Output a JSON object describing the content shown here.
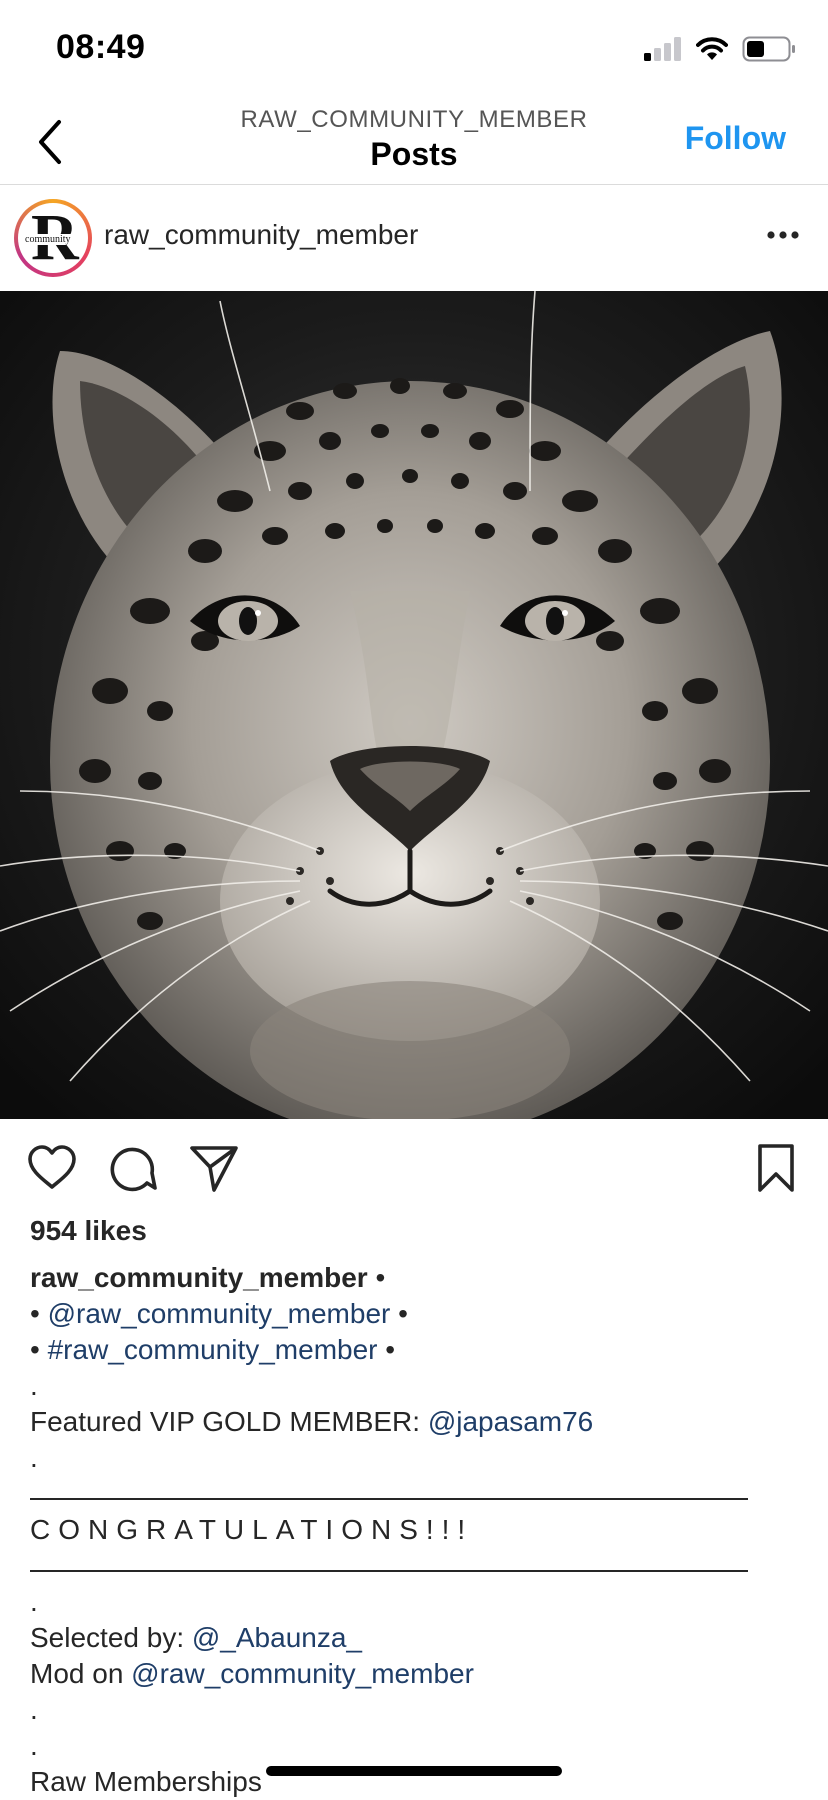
{
  "status_bar": {
    "time": "08:49"
  },
  "nav": {
    "subtitle": "RAW_COMMUNITY_MEMBER",
    "title": "Posts",
    "follow_label": "Follow"
  },
  "post": {
    "username": "raw_community_member",
    "avatar": {
      "letter": "R",
      "word": "community"
    },
    "likes": "954 likes",
    "caption": {
      "author": "raw_community_member",
      "author_suffix": " •",
      "bullet_start": "• ",
      "bullet_end": " •",
      "mention_line": "@raw_community_member",
      "hashtag_line": "#raw_community_member",
      "dot": ".",
      "featured_prefix": "Featured VIP GOLD MEMBER: ",
      "featured_user": "@japasam76",
      "congrats": "CONGRATULATIONS!!!",
      "selected_prefix": "Selected by: ",
      "selected_user": "@_Abaunza_",
      "mod_prefix": "Mod on ",
      "mod_user": "@raw_community_member",
      "memberships": "Raw Memberships"
    }
  },
  "icons": {
    "back": "chevron-left-icon",
    "more": "more-horizontal-icon",
    "like": "heart-icon",
    "comment": "comment-icon",
    "share": "send-icon",
    "save": "bookmark-icon"
  },
  "colors": {
    "follow": "#1e95f0",
    "link": "#1f3e68",
    "text": "#262626"
  }
}
